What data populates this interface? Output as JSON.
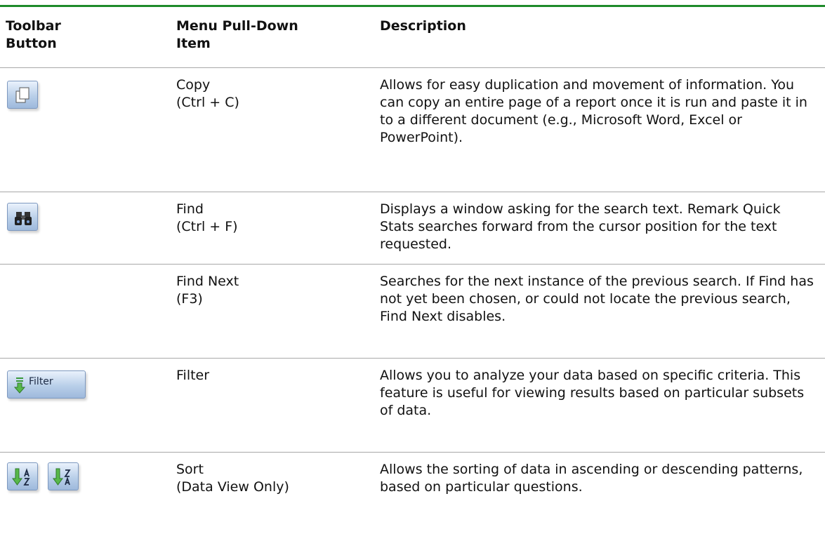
{
  "table": {
    "headers": {
      "toolbar_button": "Toolbar\nButton",
      "menu_item": "Menu Pull-Down\nItem",
      "description": "Description"
    },
    "rows": [
      {
        "icon": "copy-icon",
        "menu_item": "Copy\n(Ctrl + C)",
        "description": "Allows for easy duplication and movement of information. You can copy an entire page of a report once it is run and paste it in to a different document (e.g., Microsoft Word, Excel or PowerPoint)."
      },
      {
        "icon": "binoculars-icon",
        "menu_item": "Find\n(Ctrl + F)",
        "description": "Displays a window asking for the search text. Remark Quick Stats searches forward from the cursor position for the text requested."
      },
      {
        "icon": "",
        "menu_item": "Find Next\n(F3)",
        "description": "Searches for the next instance of the previous search. If Find has not yet been chosen, or could not locate the previous search, Find Next disables."
      },
      {
        "icon": "filter-icon",
        "button_label": "Filter",
        "menu_item": "Filter",
        "description": "Allows you to analyze your data based on specific criteria. This feature is useful for viewing results based on particular subsets of data."
      },
      {
        "icon": "sort-icons",
        "menu_item": "Sort\n(Data View Only)",
        "description": "Allows the sorting of data in ascending or descending patterns, based on particular questions."
      }
    ]
  },
  "colors": {
    "header_rule": "#1e8a2a",
    "row_rule": "#a8a8a8",
    "button_face": "#b9cfe9"
  }
}
